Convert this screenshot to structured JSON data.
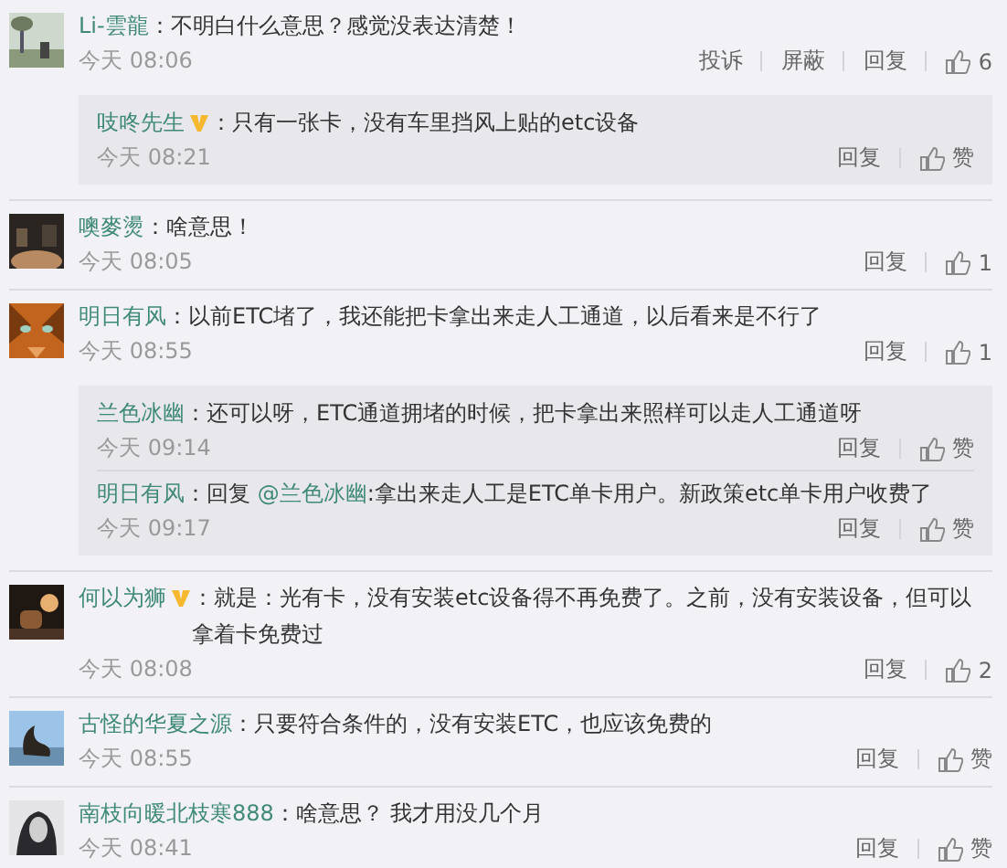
{
  "comments": [
    {
      "avatar": {
        "kind": "picture"
      },
      "user": "Li-雲龍",
      "vip": false,
      "text": "：不明白什么意思？感觉没表达清楚！",
      "time": "今天 08:06",
      "actions": [
        "投诉",
        "屏蔽",
        "回复"
      ],
      "like": "6",
      "replies": [
        {
          "user": "吱咚先生",
          "vip": true,
          "text": "：只有一张卡，没有车里挡风上贴的etc设备",
          "time": "今天 08:21",
          "actions": [
            "回复"
          ],
          "like": "赞"
        }
      ]
    },
    {
      "avatar": {
        "kind": "picture"
      },
      "user": "噢麥燙",
      "vip": false,
      "text": "：啥意思！",
      "time": "今天 08:05",
      "actions": [
        "回复"
      ],
      "like": "1"
    },
    {
      "avatar": {
        "kind": "picture"
      },
      "user": "明日有风",
      "vip": false,
      "text": "：以前ETC堵了，我还能把卡拿出来走人工通道，以后看来是不行了",
      "time": "今天 08:55",
      "actions": [
        "回复"
      ],
      "like": "1",
      "replies": [
        {
          "user": "兰色冰幽",
          "vip": false,
          "text": "：还可以呀，ETC通道拥堵的时候，把卡拿出来照样可以走人工通道呀",
          "time": "今天 09:14",
          "actions": [
            "回复"
          ],
          "like": "赞"
        },
        {
          "user": "明日有风",
          "vip": false,
          "text": "：回复 ",
          "mention": "@兰色冰幽",
          "text_after": ":拿出来走人工是ETC单卡用户。新政策etc单卡用户收费了",
          "time": "今天 09:17",
          "actions": [
            "回复"
          ],
          "like": "赞"
        }
      ]
    },
    {
      "avatar": {
        "kind": "picture"
      },
      "user": "何以为狮",
      "vip": true,
      "text": "：就是：光有卡，没有安装etc设备得不再免费了。之前，没有安装设备，但可以拿着卡免费过",
      "time": "今天 08:08",
      "actions": [
        "回复"
      ],
      "like": "2"
    },
    {
      "avatar": {
        "kind": "picture"
      },
      "user": "古怪的华夏之源",
      "vip": false,
      "text": "：只要符合条件的，没有安装ETC，也应该免费的",
      "time": "今天 08:55",
      "actions": [
        "回复"
      ],
      "like": "赞"
    },
    {
      "avatar": {
        "kind": "picture"
      },
      "user": "南枝向暖北枝寒888",
      "vip": false,
      "text": "：啥意思？ 我才用没几个月",
      "time": "今天 08:41",
      "actions": [
        "回复"
      ],
      "like": "赞"
    }
  ]
}
